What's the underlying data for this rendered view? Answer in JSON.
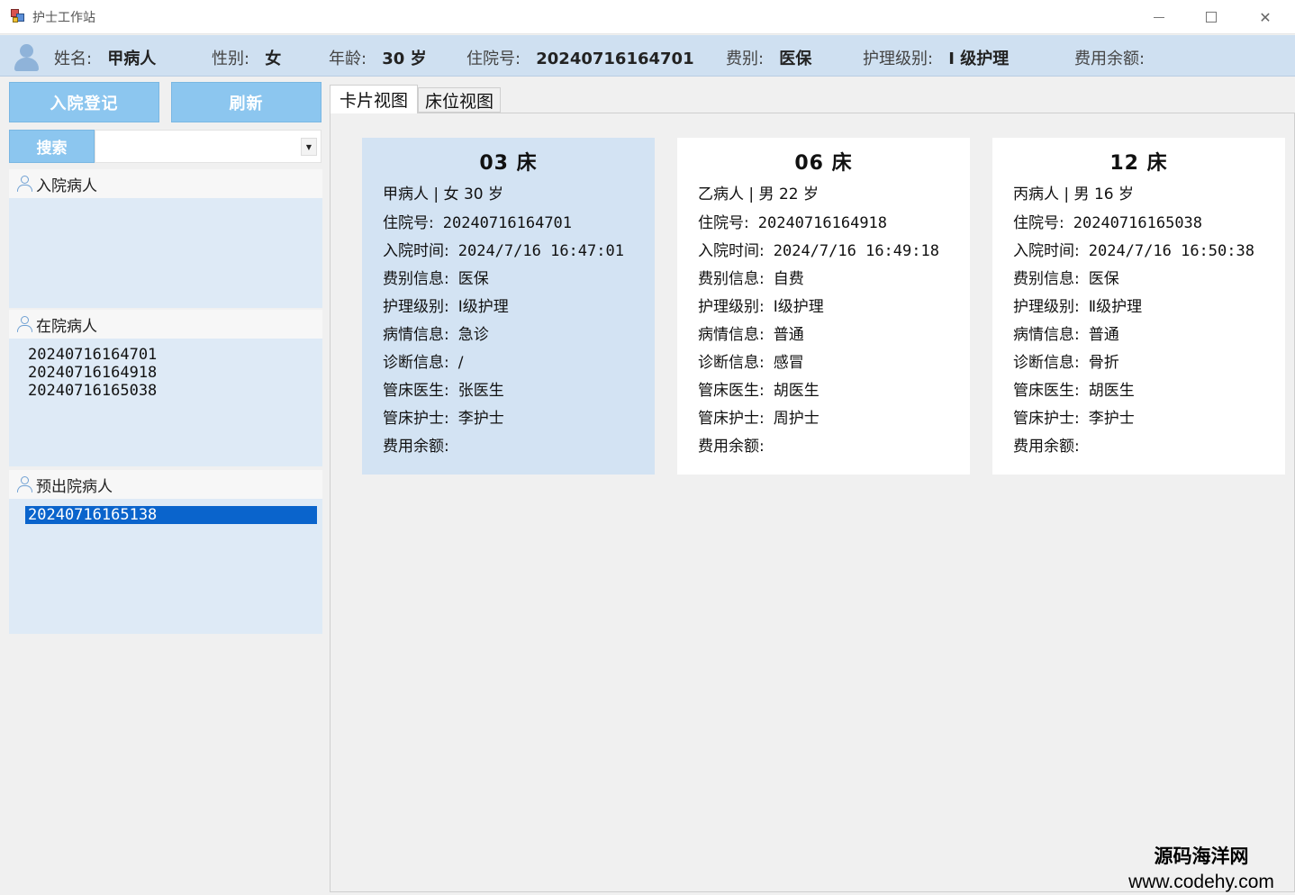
{
  "window": {
    "title": "护士工作站",
    "minimize_glyph": "—",
    "maximize_glyph": "□",
    "close_glyph": "✕"
  },
  "patient_bar": {
    "name_label": "姓名:",
    "name": "甲病人",
    "gender_label": "性别:",
    "gender": "女",
    "age_label": "年龄:",
    "age": "30 岁",
    "admission_no_label": "住院号:",
    "admission_no": "20240716164701",
    "fee_type_label": "费别:",
    "fee_type": "医保",
    "care_level_label": "护理级别:",
    "care_level": "Ⅰ 级护理",
    "balance_label": "费用余额:",
    "balance": ""
  },
  "left_panel": {
    "admit_button": "入院登记",
    "refresh_button": "刷新",
    "search_button": "搜索",
    "search_value": "",
    "groups": [
      {
        "title": "入院病人",
        "icon": "person-icon",
        "items": []
      },
      {
        "title": "在院病人",
        "icon": "person-icon",
        "items": [
          "20240716164701",
          "20240716164918",
          "20240716165038"
        ]
      },
      {
        "title": "预出院病人",
        "icon": "person-icon",
        "items": [
          "20240716165138"
        ],
        "selected": "20240716165138"
      }
    ]
  },
  "tabs": [
    {
      "label": "卡片视图",
      "active": true
    },
    {
      "label": "床位视图",
      "active": false
    }
  ],
  "cards": [
    {
      "bed": "03 床",
      "summary": "甲病人 | 女  30 岁",
      "active": true,
      "rows": [
        {
          "label": "住院号:",
          "value": "20240716164701"
        },
        {
          "label": "入院时间:",
          "value": "2024/7/16 16:47:01"
        },
        {
          "label": "费别信息:",
          "value": "医保"
        },
        {
          "label": "护理级别:",
          "value": "Ⅰ级护理"
        },
        {
          "label": "病情信息:",
          "value": "急诊"
        },
        {
          "label": "诊断信息:",
          "value": "/"
        },
        {
          "label": "管床医生:",
          "value": "张医生"
        },
        {
          "label": "管床护士:",
          "value": "李护士"
        },
        {
          "label": "费用余额:",
          "value": ""
        }
      ]
    },
    {
      "bed": "06 床",
      "summary": "乙病人 | 男  22 岁",
      "active": false,
      "rows": [
        {
          "label": "住院号:",
          "value": "20240716164918"
        },
        {
          "label": "入院时间:",
          "value": "2024/7/16 16:49:18"
        },
        {
          "label": "费别信息:",
          "value": "自费"
        },
        {
          "label": "护理级别:",
          "value": "Ⅰ级护理"
        },
        {
          "label": "病情信息:",
          "value": "普通"
        },
        {
          "label": "诊断信息:",
          "value": "感冒"
        },
        {
          "label": "管床医生:",
          "value": "胡医生"
        },
        {
          "label": "管床护士:",
          "value": "周护士"
        },
        {
          "label": "费用余额:",
          "value": ""
        }
      ]
    },
    {
      "bed": "12 床",
      "summary": "丙病人 | 男  16 岁",
      "active": false,
      "rows": [
        {
          "label": "住院号:",
          "value": "20240716165038"
        },
        {
          "label": "入院时间:",
          "value": "2024/7/16 16:50:38"
        },
        {
          "label": "费别信息:",
          "value": "医保"
        },
        {
          "label": "护理级别:",
          "value": "Ⅱ级护理"
        },
        {
          "label": "病情信息:",
          "value": "普通"
        },
        {
          "label": "诊断信息:",
          "value": "骨折"
        },
        {
          "label": "管床医生:",
          "value": "胡医生"
        },
        {
          "label": "管床护士:",
          "value": "李护士"
        },
        {
          "label": "费用余额:",
          "value": ""
        }
      ]
    }
  ],
  "watermark": {
    "line1": "源码海洋网",
    "line2": "www.codehy.com"
  },
  "colors": {
    "accent": "#8cc6ef",
    "header_bg": "#cfe0f1",
    "selection": "#0a64cc",
    "active_card": "#d3e3f3"
  }
}
